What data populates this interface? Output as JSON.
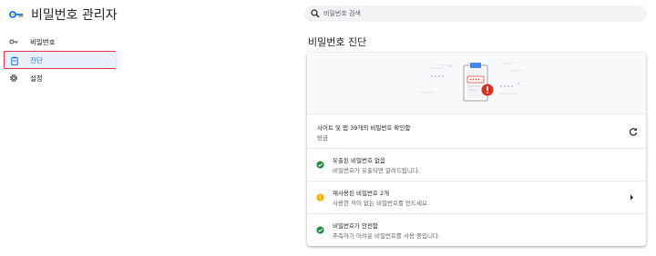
{
  "app": {
    "title": "비밀번호 관리자"
  },
  "search": {
    "placeholder": "비밀번호 검색"
  },
  "sidebar": {
    "items": [
      {
        "label": "비밀번호",
        "icon": "key-icon",
        "active": false
      },
      {
        "label": "진단",
        "icon": "checkup-clipboard-icon",
        "active": true
      },
      {
        "label": "설정",
        "icon": "gear-icon",
        "active": false
      }
    ]
  },
  "main": {
    "title": "비밀번호 진단",
    "status": {
      "title": "사이트 및 앱 39개의 비밀번호 확인함",
      "time": "방금"
    },
    "checks": [
      {
        "status": "ok",
        "icon": "green-check-icon",
        "title": "유출된 비밀번호 없음",
        "subtitle": "비밀번호가 유출되면 알려드립니다."
      },
      {
        "status": "warning",
        "icon": "warning-icon",
        "title": "재사용된 비밀번호 2개",
        "subtitle": "사용한 적이 없는 비밀번호를 만드세요."
      },
      {
        "status": "ok",
        "icon": "green-check-icon",
        "title": "비밀번호가 안전함",
        "subtitle": "추측하기 어려운 비밀번호를 사용 중입니다."
      }
    ]
  },
  "colors": {
    "accent": "#1a73e8",
    "ok": "#1e8e3e",
    "warning": "#f9ab00",
    "error": "#d93025",
    "active_outline": "#e4344c"
  }
}
